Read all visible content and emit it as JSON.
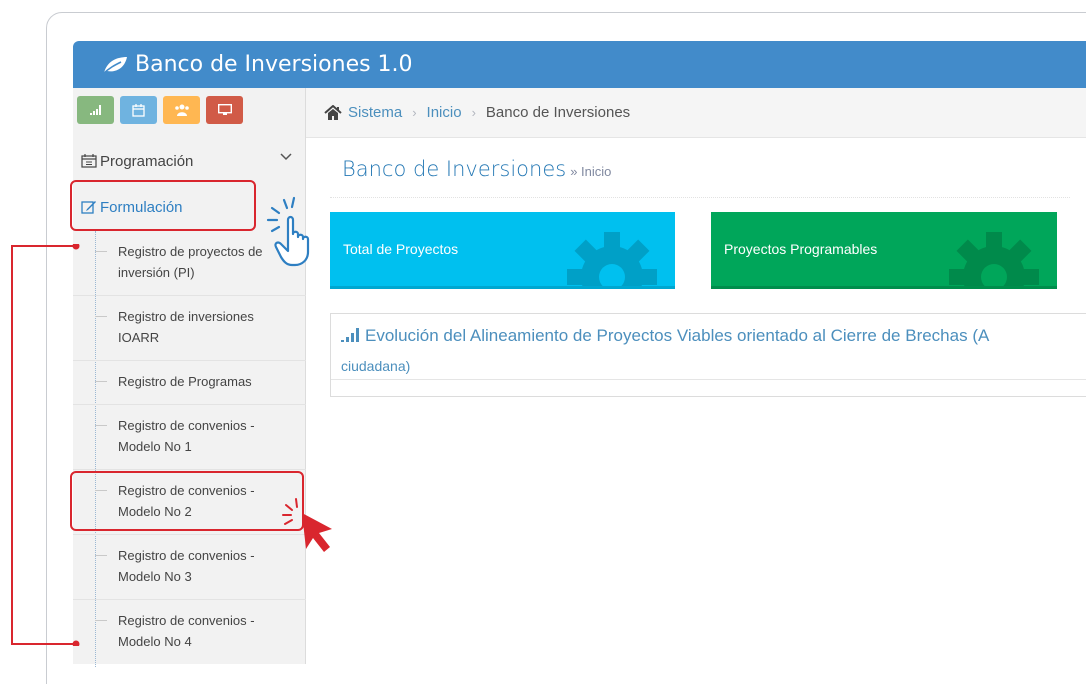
{
  "app": {
    "title": "Banco de Inversiones 1.0",
    "logo_icon": "leaf-icon"
  },
  "shortcuts": [
    {
      "icon": "signal-icon",
      "color": "#87b87f"
    },
    {
      "icon": "calendar-icon",
      "color": "#6fb3e0"
    },
    {
      "icon": "users-icon",
      "color": "#ffb752"
    },
    {
      "icon": "desktop-icon",
      "color": "#d15b47"
    }
  ],
  "sidebar": {
    "programacion": "Programación",
    "formulacion": "Formulación",
    "submenu": [
      {
        "line1": "Registro de proyectos de",
        "line2": "inversión (PI)"
      },
      {
        "line1": "Registro de inversiones",
        "line2": "IOARR"
      },
      {
        "line1": "Registro de Programas",
        "line2": ""
      },
      {
        "line1": "Registro de convenios -",
        "line2": "Modelo No 1"
      },
      {
        "line1": "Registro de convenios -",
        "line2": "Modelo No 2"
      },
      {
        "line1": "Registro de convenios -",
        "line2": "Modelo No 3"
      },
      {
        "line1": "Registro de convenios -",
        "line2": "Modelo No 4"
      }
    ]
  },
  "breadcrumb": {
    "items": [
      "Sistema",
      "Inicio",
      "Banco de Inversiones"
    ]
  },
  "page": {
    "title": "Banco de Inversiones",
    "subtitle": "» Inicio"
  },
  "cards": [
    {
      "label": "Total de Proyectos",
      "color": "#00c0ef"
    },
    {
      "label": "Proyectos Programables",
      "color": "#00a65a"
    }
  ],
  "panel": {
    "title": "Evolución del Alineamiento de Proyectos Viables orientado al Cierre de Brechas (A",
    "title_line2": "ciudadana)"
  },
  "annotation_color": "#d9262e"
}
